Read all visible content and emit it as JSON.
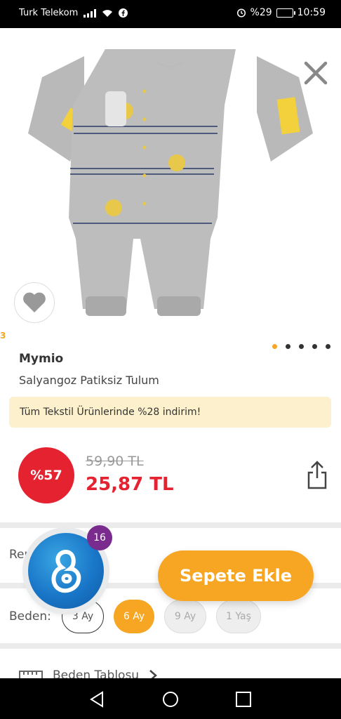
{
  "status_bar": {
    "carrier": "Turk Telekom",
    "battery": "%29",
    "time": "10:59"
  },
  "gallery": {
    "slide_index": "3",
    "dots_total": 5,
    "dots_active": 0
  },
  "product": {
    "brand": "Mymio",
    "name": "Salyangoz Patiksiz Tulum",
    "promo": "Tüm Tekstil Ürünlerinde %28 indirim!",
    "discount_badge": "%57",
    "old_price": "59,90 TL",
    "new_price": "25,87 TL"
  },
  "options": {
    "color_label": "Ren",
    "size_label": "Beden:",
    "sizes": [
      {
        "label": "3 Ay",
        "state": "outline"
      },
      {
        "label": "6 Ay",
        "state": "selected"
      },
      {
        "label": "9 Ay",
        "state": "disabled"
      },
      {
        "label": "1 Yaş",
        "state": "disabled"
      }
    ],
    "bottom_row_label": "Beden Tablosu"
  },
  "actions": {
    "add_to_cart": "Sepete Ekle",
    "assistant_badge": "16"
  },
  "colors": {
    "accent": "#f6a623",
    "sale_red": "#e5222f",
    "promo_bg": "#fcf1cc",
    "badge_purple": "#7a2b8e"
  }
}
